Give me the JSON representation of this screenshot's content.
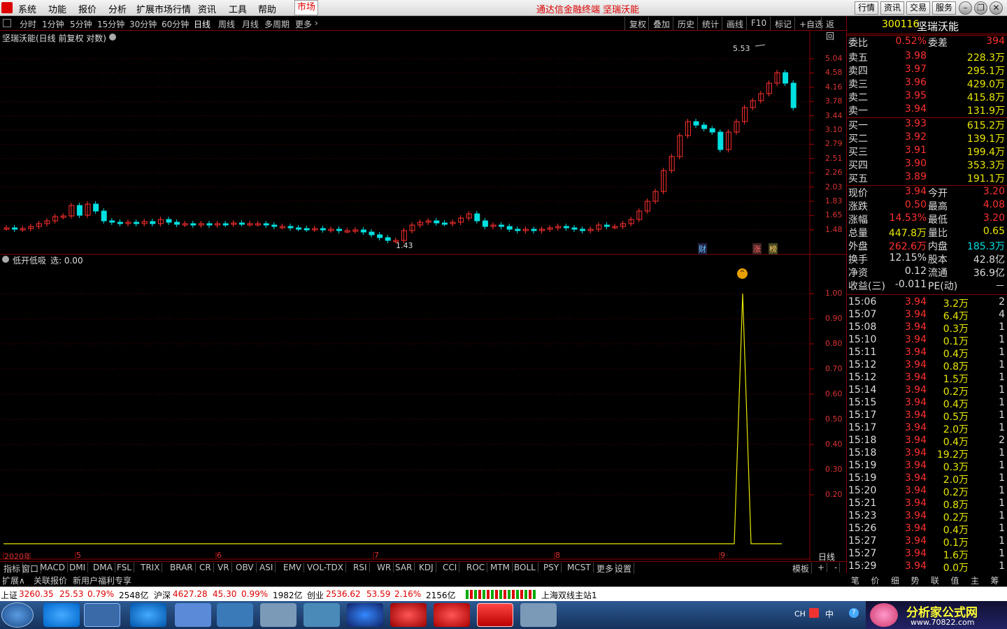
{
  "menubar": {
    "items": [
      "系统",
      "功能",
      "报价",
      "分析",
      "扩展市场行情",
      "资讯",
      "工具",
      "帮助"
    ],
    "market": "市场",
    "title": "通达信金融终端  坚瑞沃能",
    "right_buttons": [
      "行情",
      "资讯",
      "交易",
      "服务"
    ]
  },
  "periodbar": {
    "items": [
      "分时",
      "1分钟",
      "5分钟",
      "15分钟",
      "30分钟",
      "60分钟",
      "日线",
      "周线",
      "月线",
      "多周期",
      "更多"
    ],
    "active": "日线",
    "right": [
      "复权",
      "叠加",
      "历史",
      "统计",
      "画线",
      "F10",
      "标记",
      "+自选",
      "返回"
    ]
  },
  "chart": {
    "title": "坚瑞沃能(日线 前复权 对数)",
    "peak_label": "5.53",
    "low_label": "1.43",
    "badges": [
      "财",
      "涨",
      "榜"
    ],
    "price_axis": [
      "5.04",
      "4.58",
      "4.16",
      "3.78",
      "3.44",
      "3.10",
      "2.79",
      "2.51",
      "2.26",
      "2.03",
      "1.83",
      "1.65",
      "1.48"
    ],
    "ind_title": "低开低吸",
    "ind_sel": "选: 0.00",
    "ind_axis": [
      "1.00",
      "0.90",
      "0.80",
      "0.70",
      "0.60",
      "0.50",
      "0.40",
      "0.30",
      "0.20"
    ],
    "date_labels": [
      "2020年",
      "5",
      "6",
      "7",
      "8",
      "9"
    ],
    "period_label": "日线"
  },
  "chart_data": {
    "type": "line",
    "note": "",
    "series": [
      {
        "name": "低开低吸",
        "values_peak": 1.0
      }
    ]
  },
  "bottomtabs": {
    "items": [
      "指标",
      "窗口",
      "MACD",
      "DMI",
      "DMA",
      "FSL",
      "TRIX",
      "BRAR",
      "CR",
      "VR",
      "OBV",
      "ASI",
      "EMV",
      "VOL-TDX",
      "RSI",
      "WR",
      "SAR",
      "KDJ",
      "CCI",
      "ROC",
      "MTM",
      "BOLL",
      "PSY",
      "MCST",
      "更多",
      "设置"
    ],
    "right": [
      "模板",
      "+",
      "-"
    ]
  },
  "extbar": {
    "items": [
      "扩展∧",
      "关联报价",
      "新用户福利专享"
    ]
  },
  "quote": {
    "code": "300116",
    "name": "坚瑞沃能",
    "wb": {
      "label": "委比",
      "val": "0.52%",
      "label2": "委差",
      "val2": "394"
    },
    "sell": [
      [
        "卖五",
        "3.98",
        "228.3万"
      ],
      [
        "卖四",
        "3.97",
        "295.1万"
      ],
      [
        "卖三",
        "3.96",
        "429.0万"
      ],
      [
        "卖二",
        "3.95",
        "415.8万"
      ],
      [
        "卖一",
        "3.94",
        "131.9万"
      ]
    ],
    "buy": [
      [
        "买一",
        "3.93",
        "615.2万"
      ],
      [
        "买二",
        "3.92",
        "139.1万"
      ],
      [
        "买三",
        "3.91",
        "199.4万"
      ],
      [
        "买四",
        "3.90",
        "353.3万"
      ],
      [
        "买五",
        "3.89",
        "191.1万"
      ]
    ],
    "stats": [
      [
        "现价",
        "3.94",
        "今开",
        "3.20"
      ],
      [
        "涨跌",
        "0.50",
        "最高",
        "4.08"
      ],
      [
        "涨幅",
        "14.53%",
        "最低",
        "3.20"
      ],
      [
        "总量",
        "447.8万",
        "量比",
        "0.65"
      ],
      [
        "外盘",
        "262.6万",
        "内盘",
        "185.3万"
      ],
      [
        "换手",
        "12.15%",
        "股本",
        "42.8亿"
      ],
      [
        "净资",
        "0.12",
        "流通",
        "36.9亿"
      ],
      [
        "收益(三)",
        "-0.011",
        "PE(动)",
        "－"
      ]
    ],
    "ticks": [
      [
        "15:06",
        "3.94",
        "3.2万",
        "2"
      ],
      [
        "15:07",
        "3.94",
        "6.4万",
        "4"
      ],
      [
        "15:08",
        "3.94",
        "0.3万",
        "1"
      ],
      [
        "15:10",
        "3.94",
        "0.1万",
        "1"
      ],
      [
        "15:11",
        "3.94",
        "0.4万",
        "1"
      ],
      [
        "15:12",
        "3.94",
        "0.8万",
        "1"
      ],
      [
        "15:12",
        "3.94",
        "1.5万",
        "1"
      ],
      [
        "15:14",
        "3.94",
        "0.2万",
        "1"
      ],
      [
        "15:15",
        "3.94",
        "0.4万",
        "1"
      ],
      [
        "15:17",
        "3.94",
        "0.5万",
        "1"
      ],
      [
        "15:17",
        "3.94",
        "2.0万",
        "1"
      ],
      [
        "15:18",
        "3.94",
        "0.4万",
        "2"
      ],
      [
        "15:18",
        "3.94",
        "19.2万",
        "1"
      ],
      [
        "15:19",
        "3.94",
        "0.3万",
        "1"
      ],
      [
        "15:19",
        "3.94",
        "2.0万",
        "1"
      ],
      [
        "15:20",
        "3.94",
        "0.2万",
        "1"
      ],
      [
        "15:21",
        "3.94",
        "0.8万",
        "1"
      ],
      [
        "15:23",
        "3.94",
        "0.2万",
        "1"
      ],
      [
        "15:26",
        "3.94",
        "0.4万",
        "1"
      ],
      [
        "15:27",
        "3.94",
        "0.1万",
        "1"
      ],
      [
        "15:27",
        "3.94",
        "1.6万",
        "1"
      ],
      [
        "15:29",
        "3.94",
        "0.0万",
        "1"
      ]
    ],
    "tabs": [
      "笔",
      "价",
      "细",
      "势",
      "联",
      "值",
      "主",
      "筹"
    ]
  },
  "status": {
    "sh": "上证",
    "sh_v": "3260.35",
    "sh_c": "25.53",
    "sh_p": "0.79%",
    "sh_a": "2548亿",
    "hs": "沪深",
    "hs_v": "4627.28",
    "hs_c": "45.30",
    "hs_p": "0.99%",
    "hs_a": "1982亿",
    "cy": "创业",
    "cy_v": "2536.62",
    "cy_c": "53.59",
    "cy_p": "2.16%",
    "cy_a": "2156亿",
    "server": "上海双线主站1"
  },
  "taskbar": {
    "lang": "CH",
    "ime": "中",
    "watermark": "分析家公式网",
    "url": "www.70822.com"
  }
}
